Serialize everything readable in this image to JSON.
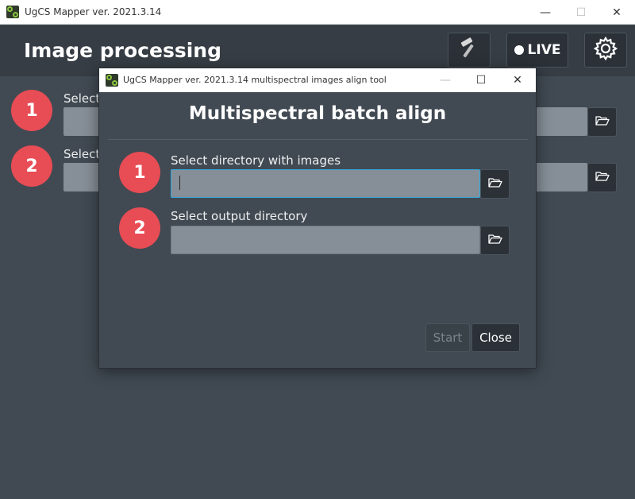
{
  "main_window": {
    "title": "UgCS Mapper ver. 2021.3.14",
    "controls": [
      "—",
      "☐",
      "✕"
    ]
  },
  "header": {
    "title": "Image processing",
    "live_label": "LIVE",
    "icons": [
      "hammer-icon",
      "live-dot-icon",
      "gear-icon"
    ]
  },
  "background_rows": [
    {
      "step": "1",
      "label": "Select"
    },
    {
      "step": "2",
      "label": "Select"
    }
  ],
  "dialog": {
    "window_title": "UgCS Mapper ver. 2021.3.14 multispectral images align tool",
    "controls": [
      "—",
      "☐",
      "✕"
    ],
    "heading": "Multispectral batch align",
    "rows": [
      {
        "step": "1",
        "label": "Select directory with images",
        "value": "",
        "focused": true
      },
      {
        "step": "2",
        "label": "Select output directory",
        "value": "",
        "focused": false
      }
    ],
    "buttons": {
      "start": "Start",
      "close": "Close"
    }
  },
  "colors": {
    "background": "#414a53",
    "header": "#363d44",
    "badge": "#e84c55",
    "field": "#868e97",
    "focus": "#34a8dc"
  }
}
